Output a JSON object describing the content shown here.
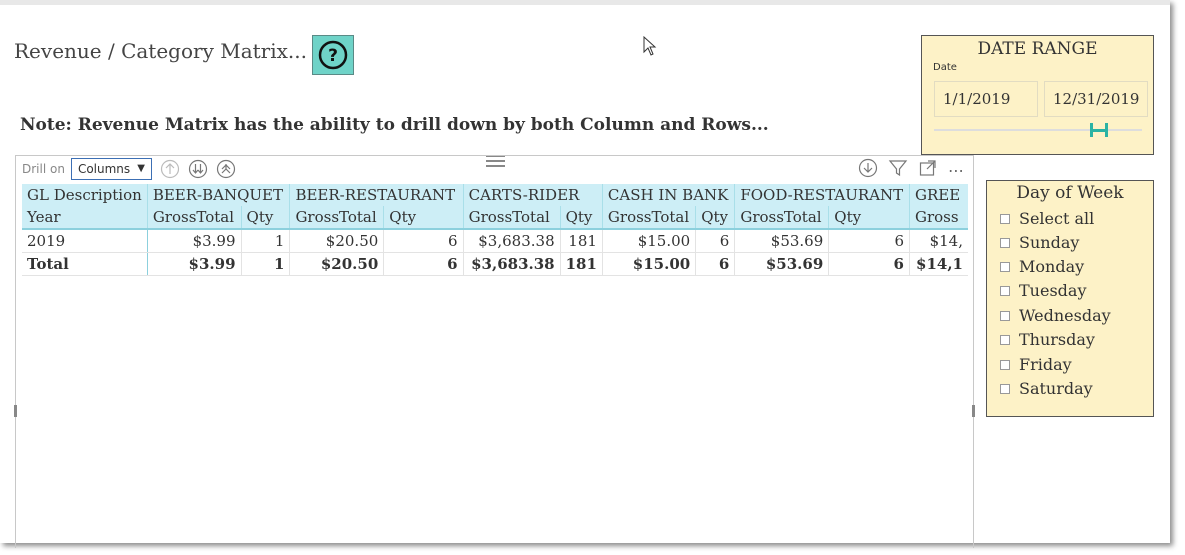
{
  "page": {
    "title": "Revenue / Category Matrix...",
    "help_icon": "question-circle-icon",
    "note": "Note: Revenue Matrix has the ability to drill down by both Column and Rows..."
  },
  "visual_header": {
    "drill_label": "Drill on",
    "drill_value": "Columns",
    "icons": [
      "drill-up-icon",
      "expand-next-level-icon",
      "expand-all-icon",
      "drill-mode-icon",
      "filter-icon",
      "focus-mode-icon",
      "more-options-icon"
    ]
  },
  "matrix": {
    "header1": [
      "GL Description",
      "BEER-BANQUET",
      "BEER-RESTAURANT",
      "CARTS-RIDER",
      "CASH IN BANK",
      "FOOD-RESTAURANT",
      "GREE"
    ],
    "header2": [
      "Year",
      "GrossTotal",
      "Qty",
      "GrossTotal",
      "Qty",
      "GrossTotal",
      "Qty",
      "GrossTotal",
      "Qty",
      "GrossTotal",
      "Qty",
      "Gross"
    ],
    "rows": [
      [
        "2019",
        "$3.99",
        "1",
        "$20.50",
        "6",
        "$3,683.38",
        "181",
        "$15.00",
        "6",
        "$53.69",
        "6",
        "$14,"
      ],
      [
        "Total",
        "$3.99",
        "1",
        "$20.50",
        "6",
        "$3,683.38",
        "181",
        "$15.00",
        "6",
        "$53.69",
        "6",
        "$14,1"
      ]
    ]
  },
  "date_range": {
    "title": "DATE RANGE",
    "field": "Date",
    "start": "1/1/2019",
    "end": "12/31/2019"
  },
  "day_of_week": {
    "title": "Day of Week",
    "items": [
      "Select all",
      "Sunday",
      "Monday",
      "Tuesday",
      "Wednesday",
      "Thursday",
      "Friday",
      "Saturday"
    ]
  },
  "colors": {
    "header_bg": "#cdeef6",
    "slicer_bg": "#fdf2c7",
    "help_bg": "#6fd3c8",
    "slider_accent": "#2bb3a4"
  }
}
